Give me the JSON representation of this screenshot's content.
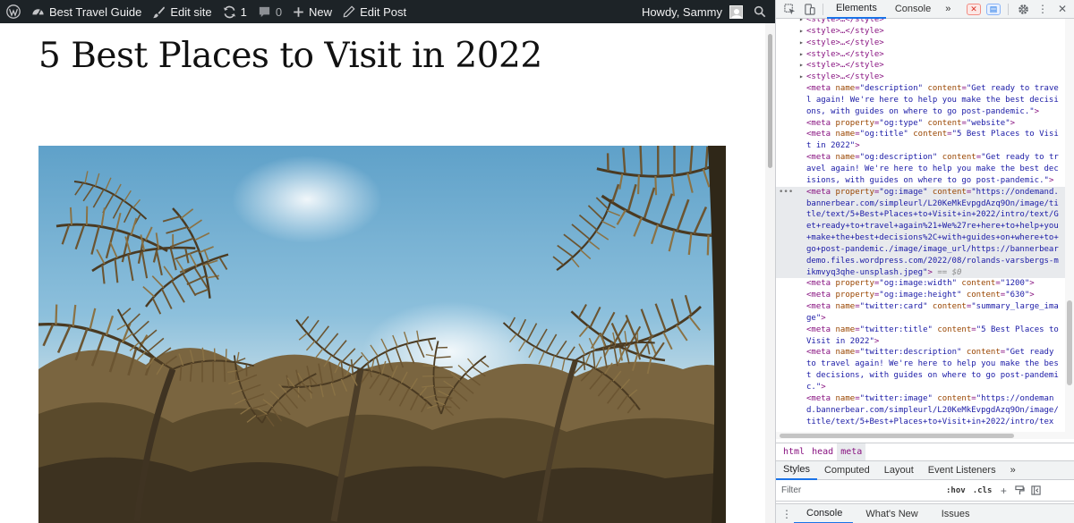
{
  "admin_bar": {
    "site_name": "Best Travel Guide",
    "edit_site": "Edit site",
    "updates_count": "1",
    "comments_count": "0",
    "new_label": "New",
    "edit_post": "Edit Post",
    "greeting": "Howdy, Sammy",
    "bg_color": "#1d2327"
  },
  "post": {
    "title": "5 Best Places to Visit in 2022",
    "hero_image": "palm-trees-photo"
  },
  "devtools": {
    "tabs": [
      "Elements",
      "Console"
    ],
    "active_tab": "Elements",
    "more_tabs": "»",
    "error_count": "",
    "message_count": "",
    "code_lines": [
      {
        "kind": "style",
        "text": "<style>…</style>"
      },
      {
        "kind": "style",
        "text": "<style>…</style>"
      },
      {
        "kind": "style",
        "text": "<style>…</style>"
      },
      {
        "kind": "style",
        "text": "<style>…</style>"
      },
      {
        "kind": "style",
        "text": "<style>…</style>"
      },
      {
        "kind": "style",
        "text": "<style>…</style>"
      }
    ],
    "meta_tags": [
      {
        "attr": "name",
        "key": "description",
        "content_lines": [
          "content=\"Get ready to trave",
          "l again! We're here to help you make the best decisi",
          "ons, with guides on where to go post-pandemic.\">"
        ]
      },
      {
        "attr": "property",
        "key": "og:type",
        "content_lines": [
          "content=\"website\">"
        ]
      },
      {
        "attr": "name",
        "key": "og:title",
        "content_lines": [
          "content=\"5 Best Places to Visi",
          "t in 2022\">"
        ]
      },
      {
        "attr": "name",
        "key": "og:description",
        "content_lines": [
          "content=\"Get ready to tr",
          "avel again! We're here to help you make the best dec",
          "isions, with guides on where to go post-pandemic.\">"
        ]
      },
      {
        "attr": "property",
        "key": "og:image",
        "selected": true,
        "content_lines": [
          "content=\"https://ondemand.",
          "bannerbear.com/simpleurl/L20KeMkEvpgdAzq9On/image/ti",
          "tle/text/5+Best+Places+to+Visit+in+2022/intro/text/G",
          "et+ready+to+travel+again%21+We%27re+here+to+help+you",
          "+make+the+best+decisions%2C+with+guides+on+where+to+",
          "go+post-pandemic./image/image_url/https://bannerbear",
          "demo.files.wordpress.com/2022/08/rolands-varsbergs-m",
          "ikmvyq3qhe-unsplash.jpeg\">"
        ],
        "selected_suffix": "== $0"
      },
      {
        "attr": "property",
        "key": "og:image:width",
        "content_lines": [
          "content=\"1200\">"
        ]
      },
      {
        "attr": "property",
        "key": "og:image:height",
        "content_lines": [
          "content=\"630\">"
        ]
      },
      {
        "attr": "name",
        "key": "twitter:card",
        "content_lines": [
          "content=\"summary_large_ima",
          "ge\">"
        ]
      },
      {
        "attr": "name",
        "key": "twitter:title",
        "content_lines": [
          "content=\"5 Best Places to",
          "Visit in 2022\">"
        ]
      },
      {
        "attr": "name",
        "key": "twitter:description",
        "content_lines": [
          "content=\"Get ready",
          "to travel again! We're here to help you make the bes",
          "t decisions, with guides on where to go post-pandemi",
          "c.\">"
        ]
      },
      {
        "attr": "name",
        "key": "twitter:image",
        "content_lines": [
          "content=\"https://ondeman",
          "d.bannerbear.com/simpleurl/L20KeMkEvpgdAzq9On/image/",
          "title/text/5+Best+Places+to+Visit+in+2022/intro/tex"
        ]
      }
    ],
    "breadcrumbs": [
      "html",
      "head",
      "meta"
    ],
    "styles_tabs": [
      "Styles",
      "Computed",
      "Layout",
      "Event Listeners"
    ],
    "styles_more": "»",
    "filter_placeholder": "Filter",
    "filter_hov": ":hov",
    "filter_cls": ".cls",
    "drawer_tabs": [
      "Console",
      "What's New",
      "Issues"
    ],
    "accent_color": "#1a73e8"
  }
}
